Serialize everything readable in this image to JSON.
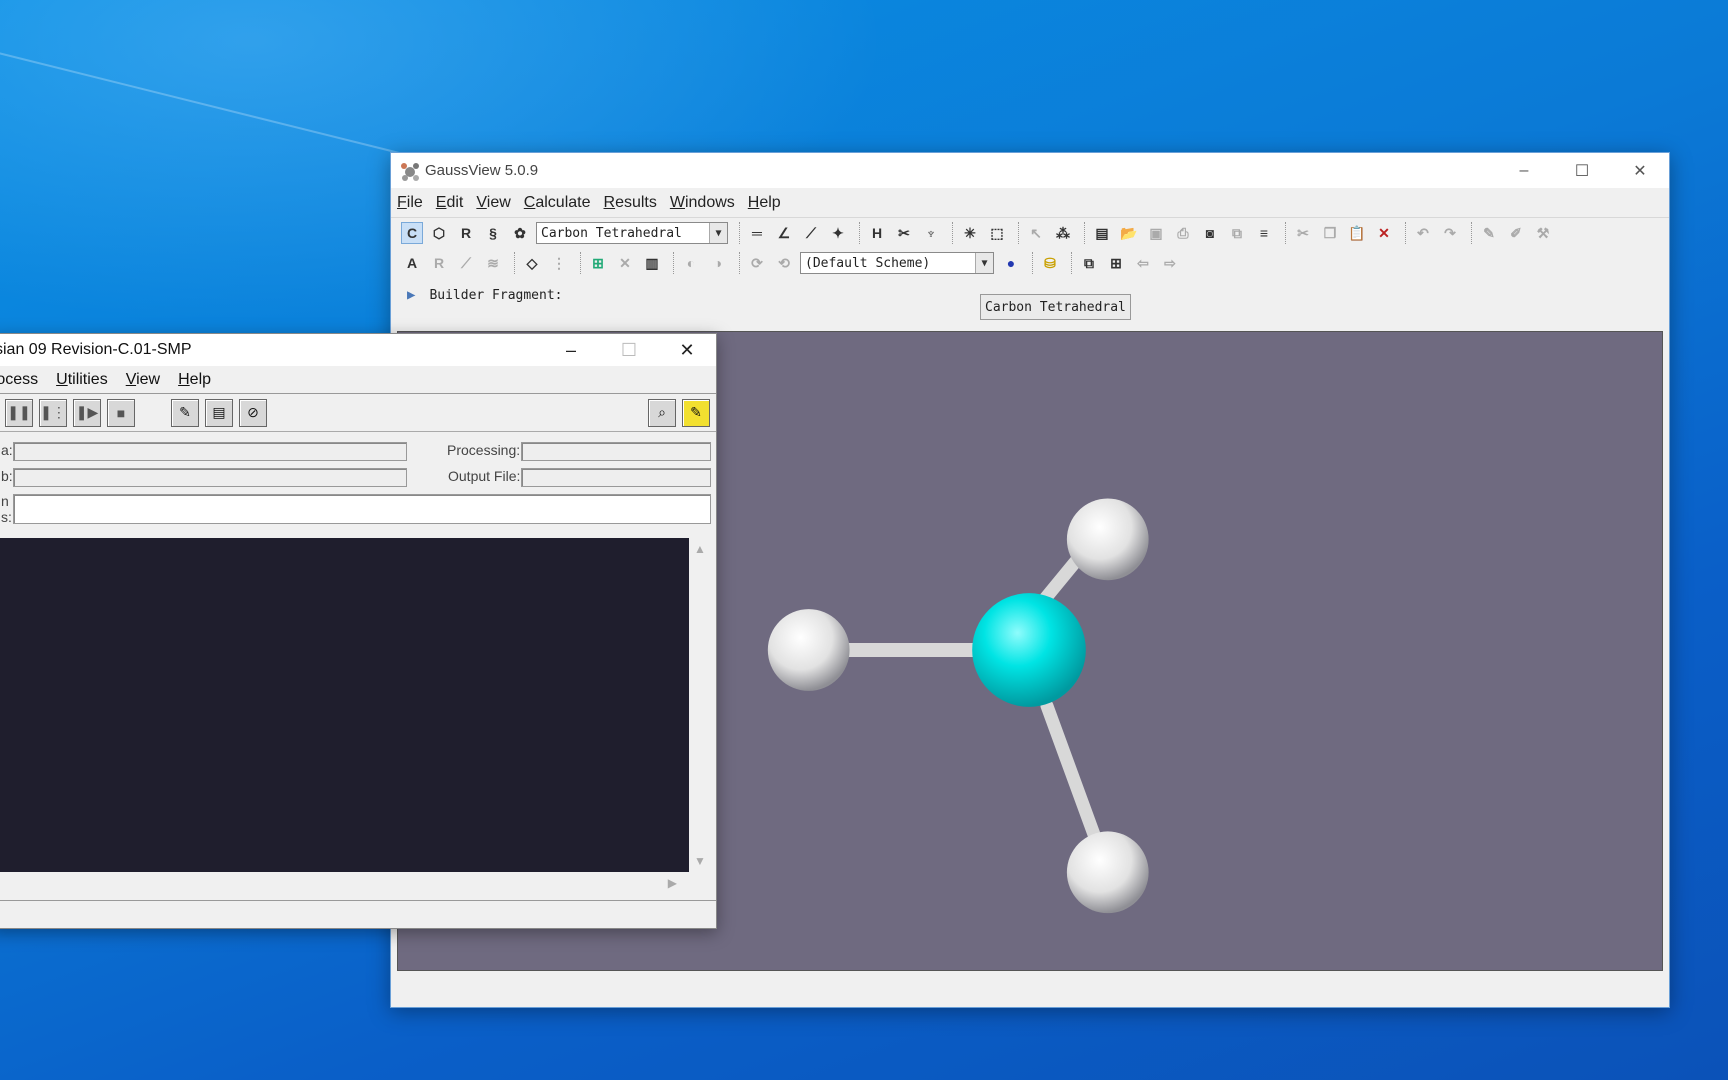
{
  "gaussview": {
    "title": "GaussView 5.0.9",
    "menu": [
      "File",
      "Edit",
      "View",
      "Calculate",
      "Results",
      "Windows",
      "Help"
    ],
    "fragment_combo": "Carbon Tetrahedral",
    "scheme_combo": "(Default Scheme)",
    "builder_label": "Builder Fragment:",
    "builder_value": "Carbon Tetrahedral",
    "controls": {
      "minimize": "–",
      "maximize": "☐",
      "close": "✕"
    }
  },
  "molecule": {
    "center_atom_color": "#00e0e0",
    "outer_atom_color": "#f4f4f4",
    "background_color": "#6f6a80"
  },
  "gaussian": {
    "title": "sian 09 Revision-C.01-SMP",
    "menu": [
      "rocess",
      "Utilities",
      "View",
      "Help"
    ],
    "labels": {
      "row1_left": "a:",
      "row2_left": "b:",
      "row3_left_a": "n",
      "row3_left_b": "s:",
      "processing": "Processing:",
      "output_file": "Output File:"
    },
    "controls": {
      "minimize": "–",
      "maximize": "☐",
      "close": "✕"
    }
  },
  "colors": {
    "desktop": "#0b7ad6",
    "selection": "#c9dff6"
  }
}
